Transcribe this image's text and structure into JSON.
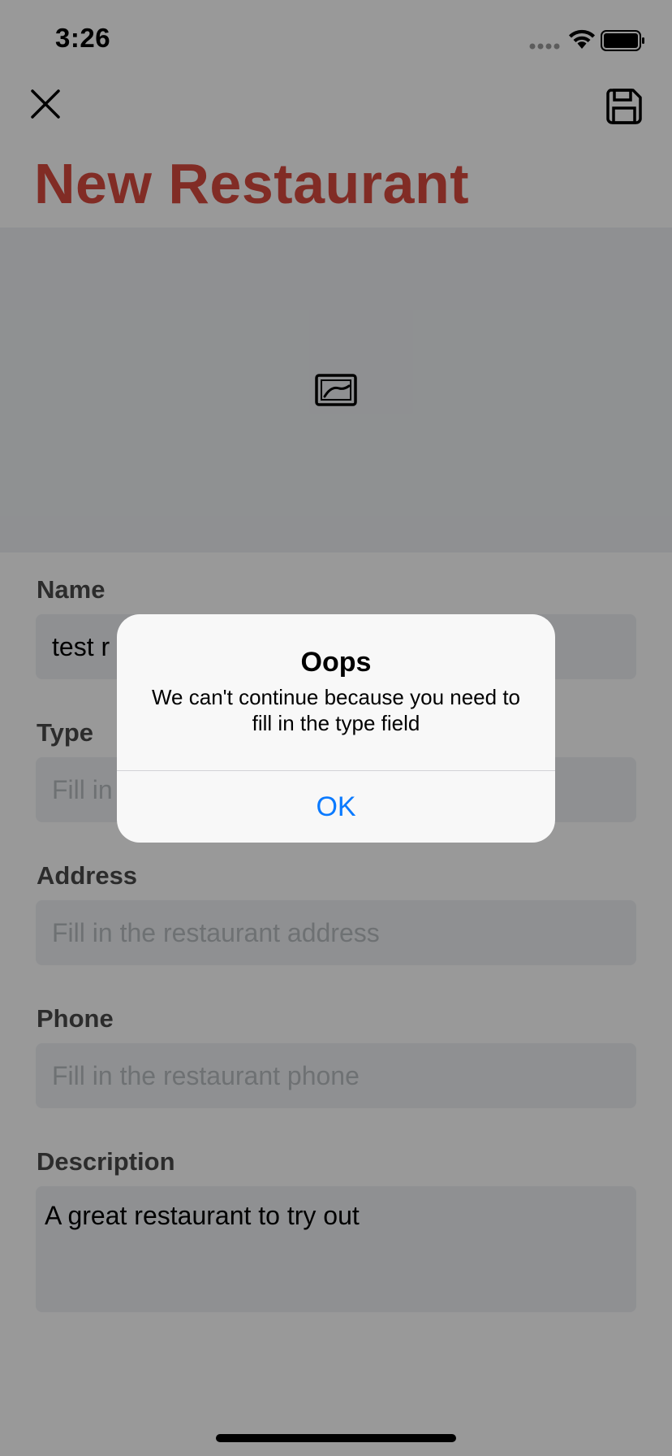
{
  "status_bar": {
    "time": "3:26"
  },
  "header": {
    "title": "New Restaurant"
  },
  "form": {
    "name": {
      "label": "Name",
      "value": "test r"
    },
    "type": {
      "label": "Type",
      "placeholder": "Fill in"
    },
    "address": {
      "label": "Address",
      "placeholder": "Fill in the restaurant address"
    },
    "phone": {
      "label": "Phone",
      "placeholder": "Fill in the restaurant phone"
    },
    "description": {
      "label": "Description",
      "value": "A great restaurant to try out"
    }
  },
  "alert": {
    "title": "Oops",
    "message": "We can't continue because you need to fill in the type field",
    "ok_label": "OK"
  },
  "colors": {
    "title": "#d84a3e",
    "field_background": "#eef1f4",
    "alert_button": "#0a7aff"
  },
  "icons": {
    "close": "close-icon",
    "save": "save-icon",
    "photo": "photo-icon"
  }
}
